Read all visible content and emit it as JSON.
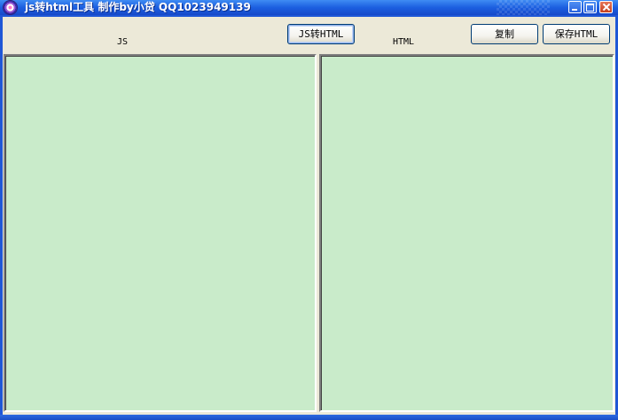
{
  "window": {
    "title": "js转html工具 制作by小贷 QQ1023949139"
  },
  "labels": {
    "js": "JS",
    "html": "HTML"
  },
  "buttons": {
    "convert": "JS转HTML",
    "copy": "复制",
    "save": "保存HTML"
  },
  "editors": {
    "js_value": "",
    "html_value": ""
  },
  "colors": {
    "editor_background": "#c9ebca",
    "titlebar": "#1c5fe0",
    "client_background": "#ece9d8"
  },
  "icons": {
    "app": "app-icon",
    "minimize": "minimize-icon",
    "maximize": "maximize-icon",
    "close": "close-icon"
  }
}
